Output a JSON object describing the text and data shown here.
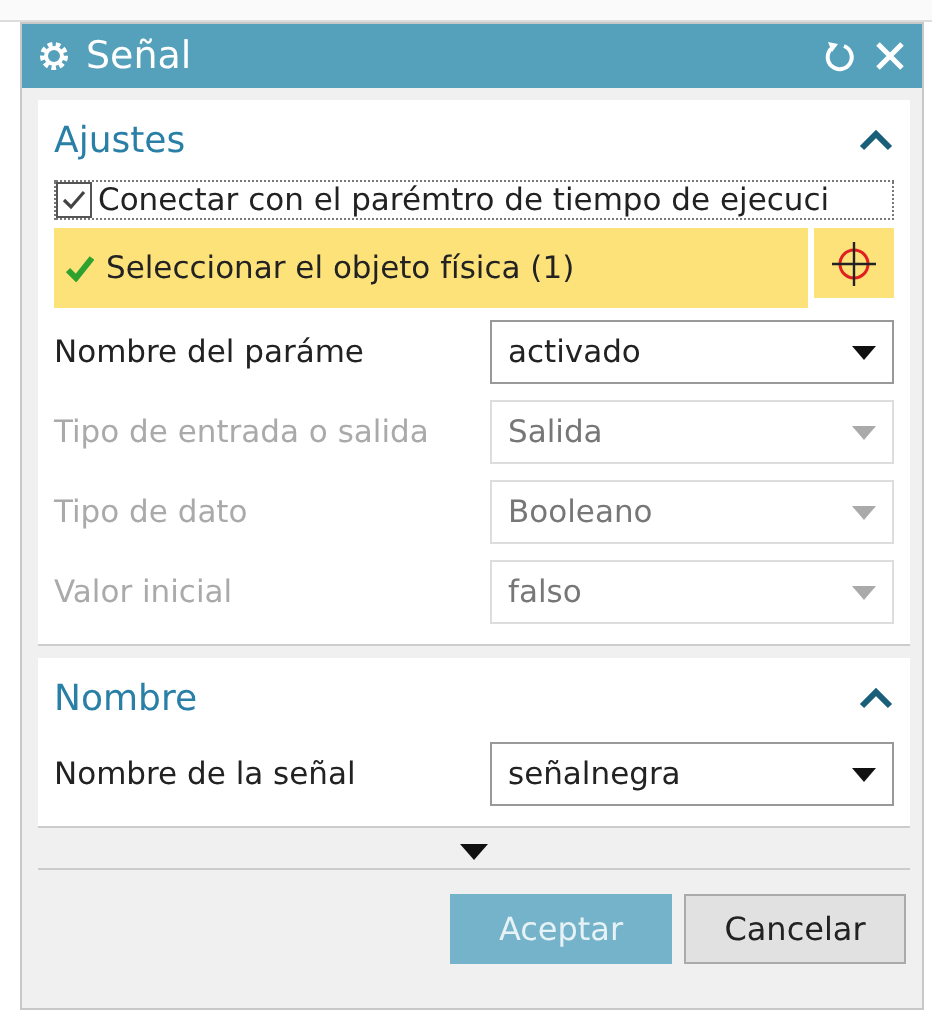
{
  "window": {
    "title": "Señal"
  },
  "sections": [
    {
      "title": "Ajustes",
      "expanded": true,
      "items": [
        {
          "kind": "checkbox",
          "label": "Conectar con el parémtro de tiempo de ejecuci",
          "checked": true
        },
        {
          "kind": "selection",
          "label": "Seleccionar el objeto física (1)",
          "done": true
        },
        {
          "kind": "dropdown",
          "label": "Nombre del paráme",
          "value": "activado",
          "disabled": false
        },
        {
          "kind": "dropdown",
          "label": "Tipo de entrada o salida",
          "value": "Salida",
          "disabled": true
        },
        {
          "kind": "dropdown",
          "label": "Tipo de dato",
          "value": "Booleano",
          "disabled": true
        },
        {
          "kind": "dropdown",
          "label": "Valor inicial",
          "value": "falso",
          "disabled": true
        }
      ]
    },
    {
      "title": "Nombre",
      "expanded": true,
      "items": [
        {
          "kind": "dropdown",
          "label": "Nombre de la señal",
          "value": "señalnegra",
          "disabled": false
        }
      ]
    }
  ],
  "buttons": [
    {
      "label": "Aceptar",
      "disabled": true
    },
    {
      "label": "Cancelar",
      "disabled": false
    }
  ]
}
